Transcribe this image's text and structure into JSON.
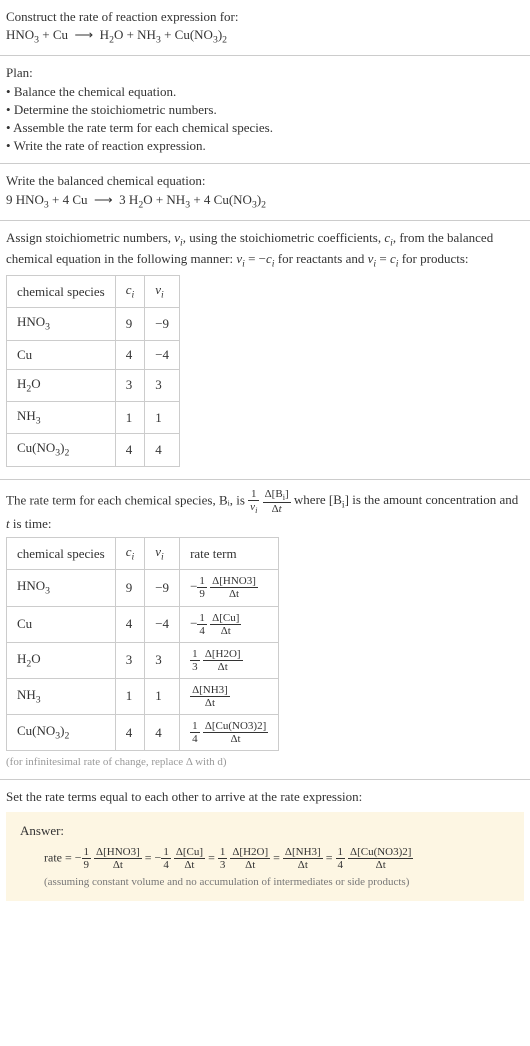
{
  "intro": {
    "title": "Construct the rate of reaction expression for:",
    "equation": "HNO₃ + Cu ⟶ H₂O + NH₃ + Cu(NO₃)₂"
  },
  "plan": {
    "title": "Plan:",
    "items": [
      "Balance the chemical equation.",
      "Determine the stoichiometric numbers.",
      "Assemble the rate term for each chemical species.",
      "Write the rate of reaction expression."
    ]
  },
  "balanced": {
    "title": "Write the balanced chemical equation:",
    "equation": "9 HNO₃ + 4 Cu ⟶ 3 H₂O + NH₃ + 4 Cu(NO₃)₂"
  },
  "assign": {
    "text": "Assign stoichiometric numbers, νᵢ, using the stoichiometric coefficients, cᵢ, from the balanced chemical equation in the following manner: νᵢ = −cᵢ for reactants and νᵢ = cᵢ for products:",
    "headers": [
      "chemical species",
      "cᵢ",
      "νᵢ"
    ],
    "rows": [
      {
        "species": "HNO₃",
        "c": "9",
        "v": "−9"
      },
      {
        "species": "Cu",
        "c": "4",
        "v": "−4"
      },
      {
        "species": "H₂O",
        "c": "3",
        "v": "3"
      },
      {
        "species": "NH₃",
        "c": "1",
        "v": "1"
      },
      {
        "species": "Cu(NO₃)₂",
        "c": "4",
        "v": "4"
      }
    ]
  },
  "rateterm": {
    "pre": "The rate term for each chemical species, Bᵢ, is ",
    "post": " where [Bᵢ] is the amount concentration and t is time:",
    "headers": [
      "chemical species",
      "cᵢ",
      "νᵢ",
      "rate term"
    ],
    "rows": [
      {
        "species": "HNO₃",
        "c": "9",
        "v": "−9",
        "coef_num": "1",
        "coef_den": "9",
        "neg": true,
        "d_num": "Δ[HNO3]",
        "d_den": "Δt"
      },
      {
        "species": "Cu",
        "c": "4",
        "v": "−4",
        "coef_num": "1",
        "coef_den": "4",
        "neg": true,
        "d_num": "Δ[Cu]",
        "d_den": "Δt"
      },
      {
        "species": "H₂O",
        "c": "3",
        "v": "3",
        "coef_num": "1",
        "coef_den": "3",
        "neg": false,
        "d_num": "Δ[H2O]",
        "d_den": "Δt"
      },
      {
        "species": "NH₃",
        "c": "1",
        "v": "1",
        "coef_num": "",
        "coef_den": "",
        "neg": false,
        "d_num": "Δ[NH3]",
        "d_den": "Δt"
      },
      {
        "species": "Cu(NO₃)₂",
        "c": "4",
        "v": "4",
        "coef_num": "1",
        "coef_den": "4",
        "neg": false,
        "d_num": "Δ[Cu(NO3)2]",
        "d_den": "Δt"
      }
    ],
    "note": "(for infinitesimal rate of change, replace Δ with d)"
  },
  "final": {
    "title": "Set the rate terms equal to each other to arrive at the rate expression:",
    "answer_label": "Answer:",
    "rate_prefix": "rate = ",
    "terms": [
      {
        "neg": true,
        "coef_num": "1",
        "coef_den": "9",
        "d_num": "Δ[HNO3]",
        "d_den": "Δt"
      },
      {
        "neg": true,
        "coef_num": "1",
        "coef_den": "4",
        "d_num": "Δ[Cu]",
        "d_den": "Δt"
      },
      {
        "neg": false,
        "coef_num": "1",
        "coef_den": "3",
        "d_num": "Δ[H2O]",
        "d_den": "Δt"
      },
      {
        "neg": false,
        "coef_num": "",
        "coef_den": "",
        "d_num": "Δ[NH3]",
        "d_den": "Δt"
      },
      {
        "neg": false,
        "coef_num": "1",
        "coef_den": "4",
        "d_num": "Δ[Cu(NO3)2]",
        "d_den": "Δt"
      }
    ],
    "note": "(assuming constant volume and no accumulation of intermediates or side products)"
  },
  "chart_data": {
    "type": "table",
    "tables": [
      {
        "title": "stoichiometric numbers",
        "columns": [
          "chemical species",
          "cᵢ",
          "νᵢ"
        ],
        "rows": [
          [
            "HNO₃",
            9,
            -9
          ],
          [
            "Cu",
            4,
            -4
          ],
          [
            "H₂O",
            3,
            3
          ],
          [
            "NH₃",
            1,
            1
          ],
          [
            "Cu(NO₃)₂",
            4,
            4
          ]
        ]
      },
      {
        "title": "rate terms",
        "columns": [
          "chemical species",
          "cᵢ",
          "νᵢ",
          "rate term"
        ],
        "rows": [
          [
            "HNO₃",
            9,
            -9,
            "−(1/9) Δ[HNO3]/Δt"
          ],
          [
            "Cu",
            4,
            -4,
            "−(1/4) Δ[Cu]/Δt"
          ],
          [
            "H₂O",
            3,
            3,
            "(1/3) Δ[H2O]/Δt"
          ],
          [
            "NH₃",
            1,
            1,
            "Δ[NH3]/Δt"
          ],
          [
            "Cu(NO₃)₂",
            4,
            4,
            "(1/4) Δ[Cu(NO3)2]/Δt"
          ]
        ]
      }
    ]
  }
}
